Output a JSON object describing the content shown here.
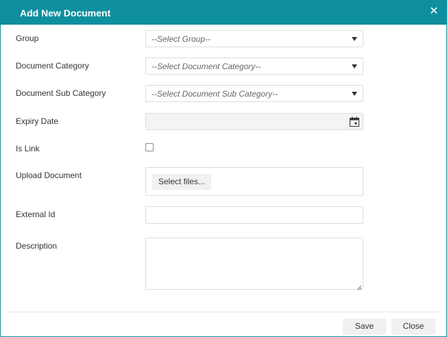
{
  "dialog": {
    "title": "Add New Document",
    "close_glyph": "✕"
  },
  "fields": {
    "group": {
      "label": "Group",
      "placeholder": "--Select Group--"
    },
    "category": {
      "label": "Document Category",
      "placeholder": "--Select Document Category--"
    },
    "sub_category": {
      "label": "Document Sub Category",
      "placeholder": "--Select Document Sub Category--"
    },
    "expiry": {
      "label": "Expiry Date",
      "value": ""
    },
    "is_link": {
      "label": "Is Link",
      "checked": false
    },
    "upload": {
      "label": "Upload Document",
      "button": "Select files..."
    },
    "external_id": {
      "label": "External Id",
      "value": ""
    },
    "description": {
      "label": "Description",
      "value": ""
    }
  },
  "footer": {
    "save": "Save",
    "close": "Close"
  },
  "colors": {
    "titlebar": "#0e8fa0",
    "border": "#dcdcdc"
  },
  "icons": {
    "close": "close-icon",
    "dropdown": "chevron-down-icon",
    "date": "calendar-icon"
  }
}
